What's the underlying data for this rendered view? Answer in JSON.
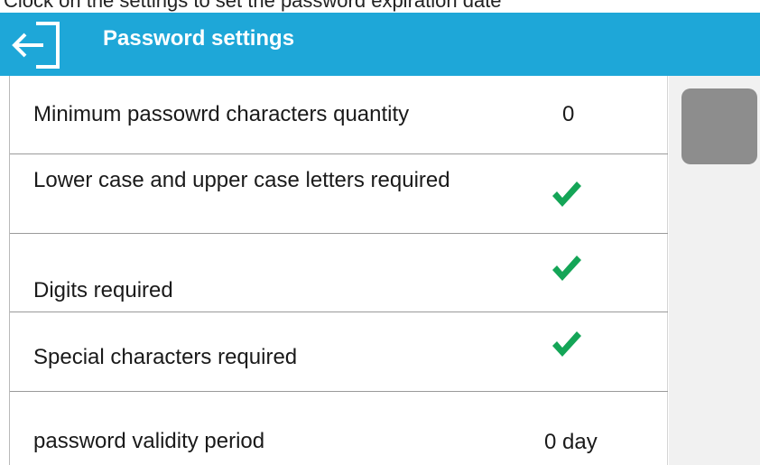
{
  "top_text": "Clock on the settings to set the password expiration date",
  "header": {
    "title": "Password settings",
    "background": "#1ea7d8",
    "back_icon": "exit-arrow-icon"
  },
  "rows": [
    {
      "label": "Minimum passowrd characters quantity",
      "value": "0"
    },
    {
      "label": "Lower case and upper case letters required",
      "checked": true
    },
    {
      "label": "Digits required",
      "checked": true
    },
    {
      "label": "Special characters required",
      "checked": true
    },
    {
      "label": "password validity period",
      "value": "0 day"
    }
  ],
  "check_color": "#14a557",
  "check_icon": "checkmark-icon"
}
